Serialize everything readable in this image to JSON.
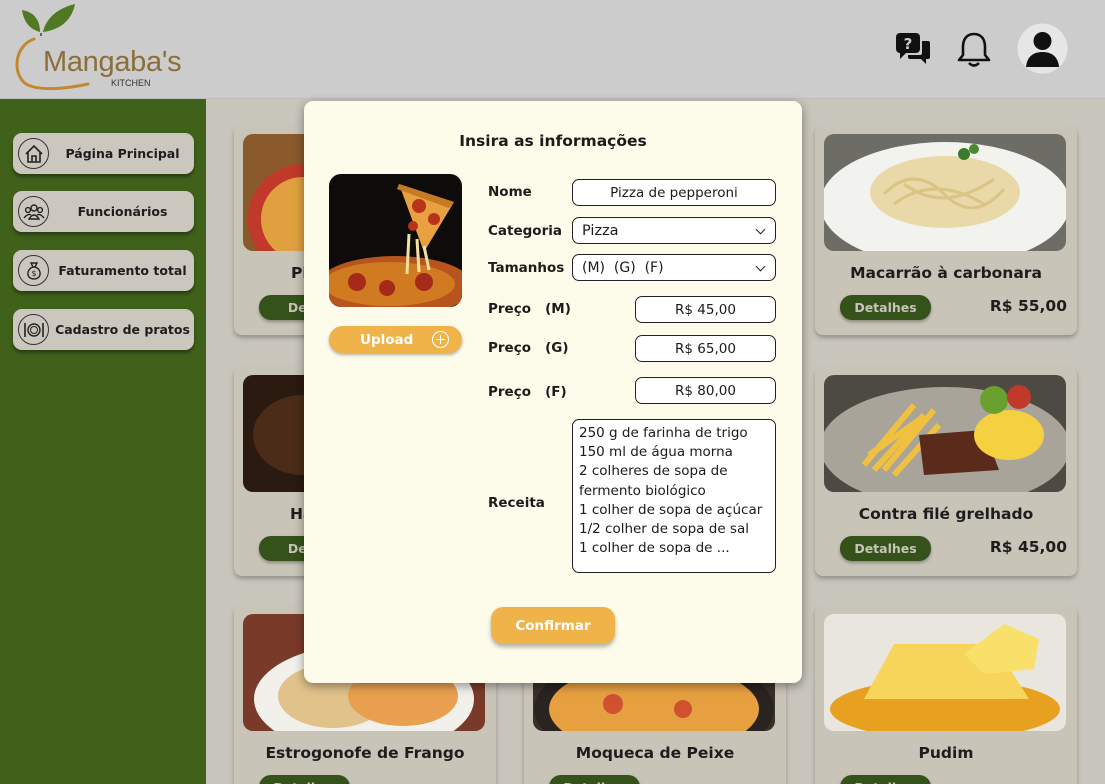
{
  "brand": {
    "name": "Mangaba's",
    "sub": "KITCHEN"
  },
  "header_icons": [
    "help-chat-icon",
    "bell-icon",
    "user-avatar-icon"
  ],
  "sidebar": {
    "items": [
      {
        "label": "Página Principal",
        "icon": "home-icon"
      },
      {
        "label": "Funcionários",
        "icon": "people-icon"
      },
      {
        "label": "Faturamento total",
        "icon": "money-bag-icon"
      },
      {
        "label": "Cadastro de pratos",
        "icon": "plate-icon"
      }
    ]
  },
  "cards": [
    {
      "title": "Pi",
      "button": "Deta",
      "price": ""
    },
    {
      "title": "Macarrão à carbonara",
      "button": "Detalhes",
      "price": "R$ 55,00"
    },
    {
      "title": "Ha",
      "button": "Deta",
      "price": ""
    },
    {
      "title": "Contra filé grelhado",
      "button": "Detalhes",
      "price": "R$ 45,00"
    },
    {
      "title": "Estrogonofe de Frango",
      "button": "Detalhes",
      "price": ""
    },
    {
      "title": "Moqueca de Peixe",
      "button": "Detalhes",
      "price": ""
    },
    {
      "title": "Pudim",
      "button": "Detalhes",
      "price": ""
    }
  ],
  "modal": {
    "title": "Insira as informações",
    "upload_label": "Upload",
    "fields": {
      "nome_label": "Nome",
      "nome_value": "Pizza de pepperoni",
      "categoria_label": "Categoria",
      "categoria_value": "Pizza",
      "tamanhos_label": "Tamanhos",
      "tamanhos_value": "(M)  (G)  (F)",
      "preco_m_label": "Preço   (M)",
      "preco_m_value": "R$ 45,00",
      "preco_g_label": "Preço   (G)",
      "preco_g_value": "R$ 65,00",
      "preco_f_label": "Preço   (F)",
      "preco_f_value": "R$ 80,00",
      "receita_label": "Receita"
    },
    "recipe_lines": [
      "250 g de farinha de trigo",
      "150 ml de água morna",
      "2 colheres de sopa de",
      "fermento biológico",
      "1 colher de sopa de açúcar",
      "1/2 colher de sopa de sal",
      "1 colher de sopa de ..."
    ],
    "confirm_label": "Confirmar"
  }
}
